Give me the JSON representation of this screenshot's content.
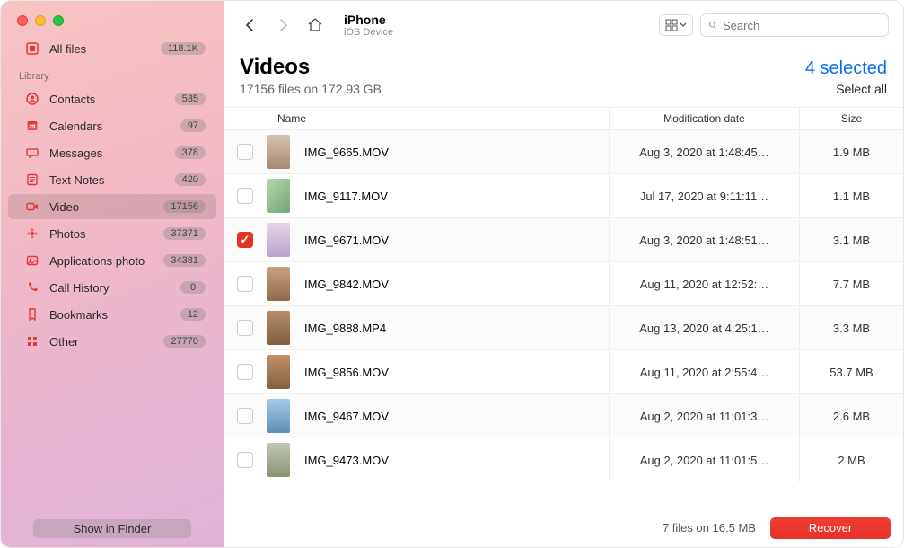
{
  "sidebar": {
    "all_files": {
      "label": "All files",
      "badge": "118.1K"
    },
    "library_label": "Library",
    "items": [
      {
        "id": "contacts",
        "label": "Contacts",
        "badge": "535"
      },
      {
        "id": "calendars",
        "label": "Calendars",
        "badge": "97"
      },
      {
        "id": "messages",
        "label": "Messages",
        "badge": "378"
      },
      {
        "id": "text-notes",
        "label": "Text Notes",
        "badge": "420"
      },
      {
        "id": "video",
        "label": "Video",
        "badge": "17156"
      },
      {
        "id": "photos",
        "label": "Photos",
        "badge": "37371"
      },
      {
        "id": "applications-photo",
        "label": "Applications photo",
        "badge": "34381"
      },
      {
        "id": "call-history",
        "label": "Call History",
        "badge": "0"
      },
      {
        "id": "bookmarks",
        "label": "Bookmarks",
        "badge": "12"
      },
      {
        "id": "other",
        "label": "Other",
        "badge": "27770"
      }
    ],
    "show_in_finder": "Show in Finder"
  },
  "topbar": {
    "device_title": "iPhone",
    "device_sub": "iOS Device",
    "search_placeholder": "Search"
  },
  "heading": {
    "title": "Videos",
    "subtitle": "17156 files on 172.93 GB",
    "selected": "4 selected",
    "select_all": "Select all"
  },
  "columns": {
    "name": "Name",
    "date": "Modification date",
    "size": "Size"
  },
  "rows": [
    {
      "name": "IMG_9665.MOV",
      "date": "Aug 3, 2020 at 1:48:45…",
      "size": "1.9 MB",
      "checked": false
    },
    {
      "name": "IMG_9117.MOV",
      "date": "Jul 17, 2020 at 9:11:11…",
      "size": "1.1 MB",
      "checked": false
    },
    {
      "name": "IMG_9671.MOV",
      "date": "Aug 3, 2020 at 1:48:51…",
      "size": "3.1 MB",
      "checked": true
    },
    {
      "name": "IMG_9842.MOV",
      "date": "Aug 11, 2020 at 12:52:…",
      "size": "7.7 MB",
      "checked": false
    },
    {
      "name": "IMG_9888.MP4",
      "date": "Aug 13, 2020 at 4:25:1…",
      "size": "3.3 MB",
      "checked": false
    },
    {
      "name": "IMG_9856.MOV",
      "date": "Aug 11, 2020 at 2:55:4…",
      "size": "53.7 MB",
      "checked": false
    },
    {
      "name": "IMG_9467.MOV",
      "date": "Aug 2, 2020 at 11:01:3…",
      "size": "2.6 MB",
      "checked": false
    },
    {
      "name": "IMG_9473.MOV",
      "date": "Aug 2, 2020 at 11:01:5…",
      "size": "2 MB",
      "checked": false
    }
  ],
  "footer": {
    "info": "7 files on 16.5 MB",
    "recover": "Recover"
  }
}
